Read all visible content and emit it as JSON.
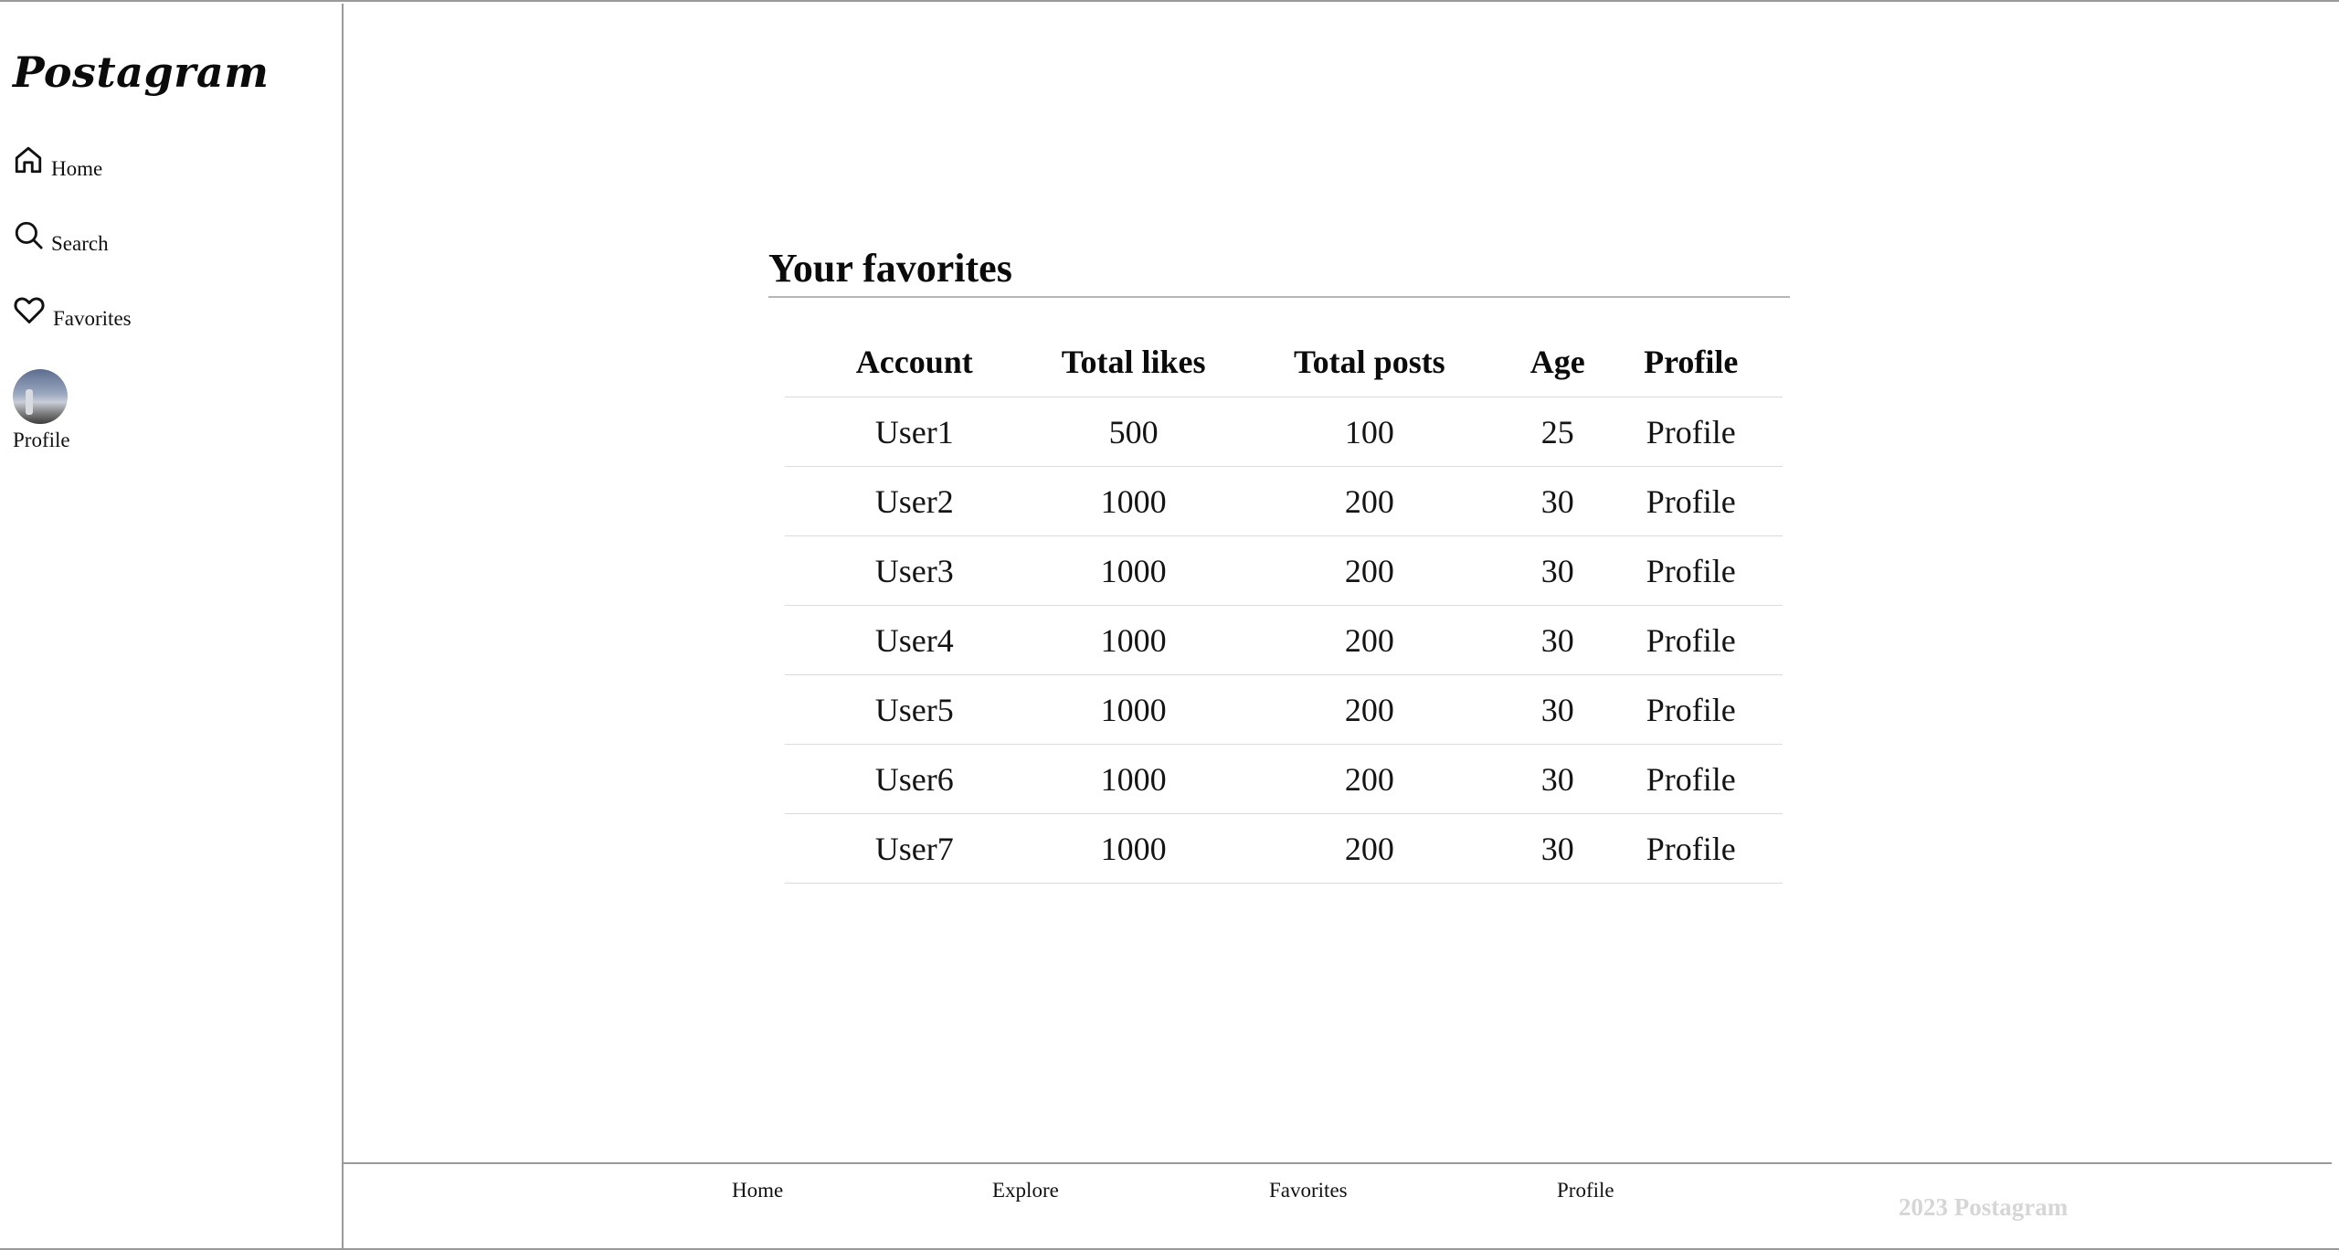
{
  "brand": {
    "logo": "Postagram"
  },
  "sidebar": {
    "items": [
      {
        "label": "Home",
        "icon": "home-icon"
      },
      {
        "label": "Search",
        "icon": "search-icon"
      },
      {
        "label": "Favorites",
        "icon": "heart-icon"
      },
      {
        "label": "Profile",
        "icon": "avatar"
      }
    ]
  },
  "main": {
    "title": "Your favorites",
    "table": {
      "headers": [
        "Account",
        "Total likes",
        "Total posts",
        "Age",
        "Profile"
      ],
      "rows": [
        [
          "User1",
          "500",
          "100",
          "25",
          "Profile"
        ],
        [
          "User2",
          "1000",
          "200",
          "30",
          "Profile"
        ],
        [
          "User3",
          "1000",
          "200",
          "30",
          "Profile"
        ],
        [
          "User4",
          "1000",
          "200",
          "30",
          "Profile"
        ],
        [
          "User5",
          "1000",
          "200",
          "30",
          "Profile"
        ],
        [
          "User6",
          "1000",
          "200",
          "30",
          "Profile"
        ],
        [
          "User7",
          "1000",
          "200",
          "30",
          "Profile"
        ]
      ]
    }
  },
  "footer": {
    "links": [
      "Home",
      "Explore",
      "Favorites",
      "Profile"
    ],
    "copyright": "2023 Postagram"
  },
  "colors": {
    "rule": "#9a9a9a",
    "copyright": "#d6d6d6",
    "text": "#111111"
  }
}
